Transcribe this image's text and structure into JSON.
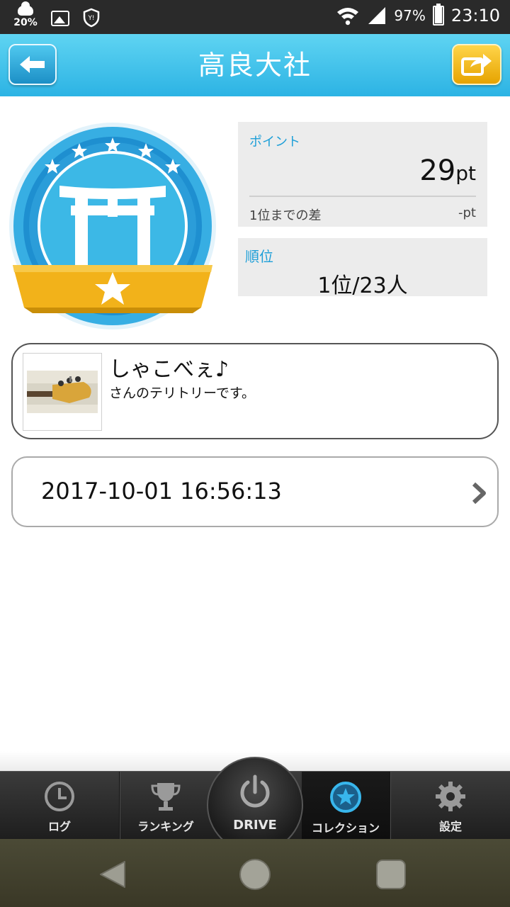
{
  "status_bar": {
    "weather_percent": "20%",
    "battery_percent": "97%",
    "battery_level": 0.97,
    "time": "23:10"
  },
  "header": {
    "title": "高良大社",
    "back_icon": "back-arrow-icon",
    "share_icon": "share-icon"
  },
  "badge": {
    "icon": "torii-shrine-badge-icon",
    "colors": {
      "ring": "#2a9fd8",
      "inner": "#3cb8e6",
      "ribbon": "#f2b21a",
      "star": "#ffffff"
    }
  },
  "points": {
    "label": "ポイント",
    "value": "29",
    "unit": "pt",
    "gap_label": "1位までの差",
    "gap_value": "-pt"
  },
  "rank": {
    "label": "順位",
    "value": "1位/23人"
  },
  "owner": {
    "name": "しゃこべぇ♪",
    "description": "さんのテリトリーです。"
  },
  "visit": {
    "datetime": "2017-10-01 16:56:13"
  },
  "tabs": [
    {
      "label": "ログ",
      "icon": "clock-icon"
    },
    {
      "label": "ランキング",
      "icon": "trophy-icon"
    },
    {
      "label": "DRIVE",
      "icon": "power-icon"
    },
    {
      "label": "コレクション",
      "icon": "star-circle-icon"
    },
    {
      "label": "設定",
      "icon": "gear-icon"
    }
  ],
  "colors": {
    "accent": "#1e9fd8",
    "header_top": "#5fd4f2",
    "header_bottom": "#2cb3e4",
    "share": "#f2b21a"
  }
}
